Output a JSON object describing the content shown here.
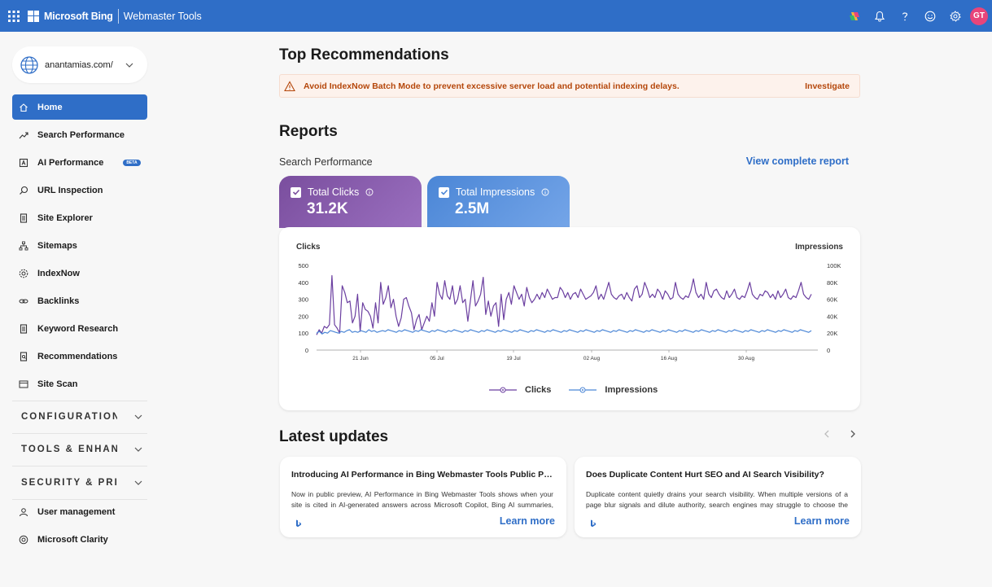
{
  "topbar": {
    "brand": "Microsoft Bing",
    "product": "Webmaster Tools",
    "avatar_initials": "GT"
  },
  "sidebar": {
    "site": "anantamias.com/",
    "items": [
      {
        "label": "Home",
        "icon": "home-icon",
        "active": true
      },
      {
        "label": "Search Performance",
        "icon": "trend-icon"
      },
      {
        "label": "AI Performance",
        "icon": "ai-icon",
        "badge": "BETA"
      },
      {
        "label": "URL Inspection",
        "icon": "search-icon"
      },
      {
        "label": "Site Explorer",
        "icon": "document-icon"
      },
      {
        "label": "Sitemaps",
        "icon": "sitemap-icon"
      },
      {
        "label": "IndexNow",
        "icon": "gear-icon"
      },
      {
        "label": "Backlinks",
        "icon": "link-icon"
      },
      {
        "label": "Keyword Research",
        "icon": "document-icon"
      },
      {
        "label": "Recommendations",
        "icon": "recommendations-icon"
      },
      {
        "label": "Site Scan",
        "icon": "scan-icon"
      }
    ],
    "sections": [
      "CONFIGURATION",
      "TOOLS & ENHANCEMENTS",
      "SECURITY & PRIVACY"
    ],
    "bottom_items": [
      {
        "label": "User management",
        "icon": "user-icon"
      },
      {
        "label": "Microsoft Clarity",
        "icon": "clarity-icon"
      }
    ]
  },
  "main": {
    "top_title": "Top Recommendations",
    "alert": {
      "text": "Avoid IndexNow Batch Mode to prevent excessive server load and potential indexing delays.",
      "action": "Investigate",
      "color": "#b5470b"
    },
    "reports_title": "Reports",
    "search_performance_title": "Search Performance",
    "view_report": "View complete report",
    "metrics": [
      {
        "label": "Total Clicks",
        "value": "31.2K",
        "color": "#7a4e9e"
      },
      {
        "label": "Total Impressions",
        "value": "2.5M",
        "color": "#4b86d6"
      }
    ],
    "latest_title": "Latest updates",
    "updates": [
      {
        "title": "Introducing AI Performance in Bing Webmaster Tools Public Preview",
        "body": "Now in public preview, AI Performance in Bing Webmaster Tools shows when your site is cited in AI-generated answers across Microsoft Copilot, Bing AI summaries, and select partner integrations.",
        "link": "Learn more"
      },
      {
        "title": "Does Duplicate Content Hurt SEO and AI Search Visibility?",
        "body": "Duplicate content quietly drains your search visibility. When multiple versions of a page blur signals and dilute authority, search engines may struggle to choose the right URL.",
        "link": "Learn more"
      }
    ]
  },
  "chart_data": {
    "type": "line",
    "left_axis_label": "Clicks",
    "right_axis_label": "Impressions",
    "left_ticks": [
      "500",
      "400",
      "300",
      "200",
      "100",
      "0"
    ],
    "right_ticks": [
      "100K",
      "80K",
      "60K",
      "40K",
      "20K",
      "0"
    ],
    "ylim_left": [
      0,
      500
    ],
    "ylim_right": [
      0,
      100000
    ],
    "x_ticks": [
      "21 Jun",
      "05 Jul",
      "19 Jul",
      "02 Aug",
      "16 Aug",
      "30 Aug"
    ],
    "series": [
      {
        "name": "Clicks",
        "color": "#6b3fa0",
        "axis": "left",
        "values": [
          90,
          120,
          100,
          140,
          130,
          150,
          440,
          150,
          130,
          100,
          380,
          340,
          280,
          290,
          160,
          200,
          330,
          110,
          280,
          240,
          230,
          200,
          130,
          280,
          160,
          400,
          270,
          310,
          380,
          250,
          300,
          200,
          140,
          190,
          300,
          310,
          260,
          220,
          120,
          180,
          210,
          120,
          160,
          200,
          170,
          280,
          200,
          400,
          330,
          300,
          410,
          320,
          300,
          380,
          270,
          300,
          380,
          280,
          300,
          170,
          290,
          410,
          260,
          290,
          330,
          430,
          210,
          290,
          200,
          260,
          280,
          140,
          330,
          180,
          300,
          340,
          270,
          380,
          340,
          300,
          330,
          260,
          370,
          310,
          280,
          300,
          330,
          300,
          340,
          310,
          360,
          330,
          300,
          310,
          310,
          370,
          350,
          310,
          340,
          300,
          330,
          340,
          310,
          360,
          330,
          300,
          310,
          320,
          340,
          380,
          300,
          330,
          300,
          350,
          400,
          330,
          310,
          300,
          320,
          330,
          300,
          340,
          310,
          290,
          360,
          380,
          310,
          330,
          400,
          360,
          310,
          330,
          310,
          360,
          340,
          300,
          350,
          330,
          300,
          310,
          400,
          330,
          310,
          300,
          320,
          310,
          350,
          420,
          340,
          310,
          330,
          300,
          400,
          330,
          310,
          350,
          360,
          330,
          310,
          300,
          350,
          310,
          330,
          360,
          310,
          300,
          320,
          310,
          350,
          400,
          330,
          310,
          300,
          330,
          320,
          350,
          340,
          310,
          330,
          300,
          350,
          310,
          330,
          360,
          310,
          300,
          320,
          310,
          350,
          400,
          330,
          310,
          300,
          330
        ]
      },
      {
        "name": "Impressions",
        "color": "#4b86d6",
        "axis": "right",
        "values": [
          20000,
          22000,
          19000,
          21000,
          20000,
          23000,
          22000,
          21000,
          20000,
          22000,
          21000,
          23000,
          24000,
          21000,
          22000,
          21000,
          23000,
          22000,
          21000,
          24000,
          22000,
          23000,
          21000,
          22000,
          23000,
          22000,
          24000,
          23000,
          22000,
          21000,
          23000,
          22000,
          24000,
          23000,
          22000,
          21000,
          23000,
          22000,
          24000,
          23000,
          22000,
          21000,
          23000,
          22000,
          24000,
          23000,
          22000,
          21000,
          23000,
          22000,
          24000,
          23000,
          22000,
          21000,
          23000,
          22000,
          24000,
          23000,
          22000,
          21000,
          23000,
          22000,
          24000,
          23000,
          22000,
          21000,
          23000,
          22000,
          24000,
          23000,
          22000,
          21000,
          23000,
          22000,
          24000,
          23000,
          22000,
          21000,
          23000,
          22000,
          24000,
          23000,
          22000,
          21000,
          23000,
          22000,
          24000,
          23000,
          22000,
          21000,
          23000,
          22000,
          24000,
          23000,
          22000,
          21000,
          23000,
          22000,
          24000,
          23000,
          22000,
          21000,
          23000,
          22000,
          24000,
          23000,
          22000,
          21000,
          23000,
          22000,
          24000,
          23000,
          22000,
          21000,
          23000,
          22000,
          24000,
          23000,
          22000,
          21000,
          23000,
          22000,
          24000,
          23000,
          22000,
          21000,
          23000,
          22000,
          24000,
          23000,
          22000,
          21000,
          23000,
          22000,
          24000,
          23000,
          22000,
          21000,
          23000,
          22000,
          24000,
          23000,
          22000,
          21000,
          23000,
          22000,
          24000,
          23000,
          22000,
          21000,
          23000,
          22000,
          24000,
          23000,
          22000,
          21000,
          23000,
          22000,
          24000,
          23000,
          22000,
          21000,
          23000,
          22000,
          24000,
          23000,
          22000,
          21000,
          23000,
          22000,
          24000,
          23000,
          22000,
          21000,
          23000,
          22000,
          24000,
          23000,
          22000,
          21000,
          23000
        ]
      }
    ],
    "grid": false,
    "legend_position": "bottom"
  }
}
